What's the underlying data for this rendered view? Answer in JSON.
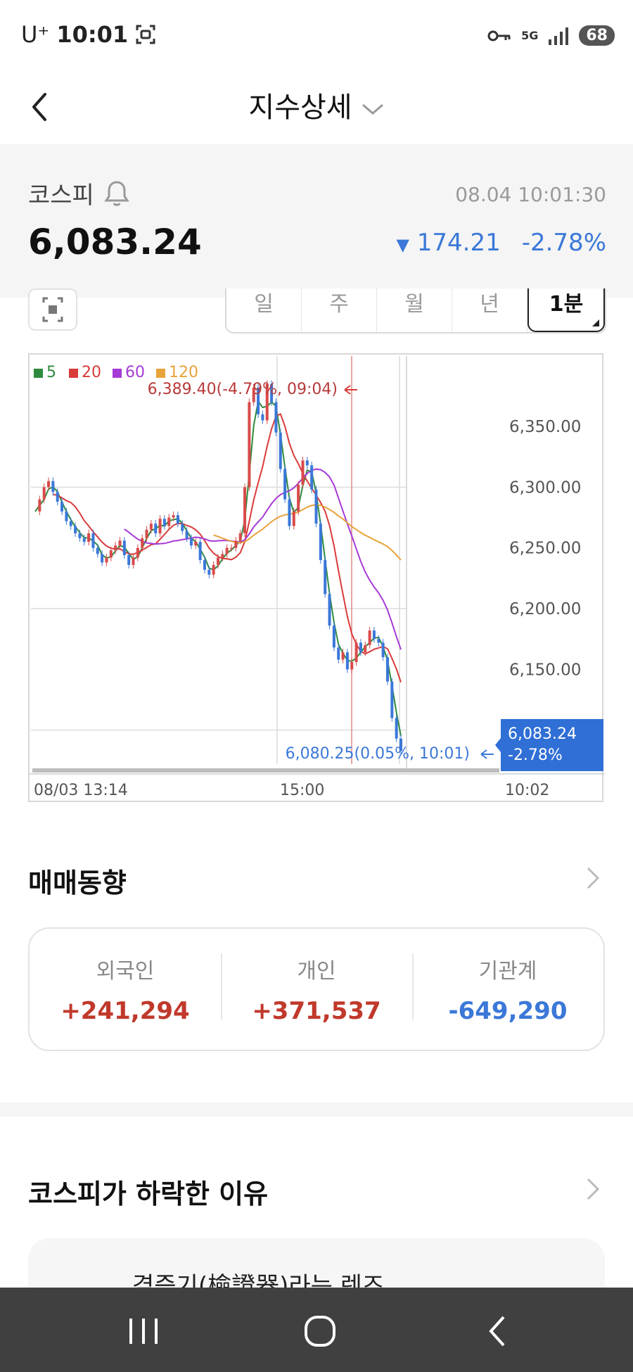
{
  "status_bar": {
    "carrier": "U⁺",
    "time": "10:01",
    "network": "5G",
    "battery": "68"
  },
  "header": {
    "title": "지수상세"
  },
  "index": {
    "name": "코스피",
    "timestamp": "08.04 10:01:30",
    "value": "6,083.24",
    "change_points": "174.21",
    "change_percent": "-2.78%",
    "direction": "down"
  },
  "period_tabs": [
    {
      "label": "일",
      "active": false
    },
    {
      "label": "주",
      "active": false
    },
    {
      "label": "월",
      "active": false
    },
    {
      "label": "년",
      "active": false
    },
    {
      "label": "1분",
      "active": true
    }
  ],
  "chart_data": {
    "type": "candlestick",
    "legend": [
      {
        "label": "5",
        "color": "#2e8b3e"
      },
      {
        "label": "20",
        "color": "#d93b3b"
      },
      {
        "label": "60",
        "color": "#a63ad6"
      },
      {
        "label": "120",
        "color": "#e8a33a"
      }
    ],
    "y_ticks": [
      "6,350.00",
      "6,300.00",
      "6,250.00",
      "6,200.00",
      "6,150.00"
    ],
    "ylim": [
      6072,
      6408
    ],
    "x_ticks": [
      "08/03 13:14",
      "15:00",
      "10:02"
    ],
    "high_marker": "6,389.40(-4.79%, 09:04)",
    "low_marker": "6,080.25(0.05%, 10:01)",
    "current": {
      "value": "6,083.24",
      "change": "-2.78%"
    },
    "price_path": [
      6280,
      6290,
      6300,
      6305,
      6296,
      6288,
      6280,
      6272,
      6268,
      6262,
      6258,
      6255,
      6262,
      6250,
      6245,
      6238,
      6242,
      6248,
      6252,
      6256,
      6244,
      6236,
      6242,
      6250,
      6258,
      6265,
      6270,
      6262,
      6274,
      6268,
      6275,
      6277,
      6270,
      6264,
      6258,
      6252,
      6255,
      6240,
      6232,
      6228,
      6236,
      6242,
      6245,
      6250,
      6250,
      6256,
      6262,
      6300,
      6370,
      6382,
      6360,
      6355,
      6385,
      6370,
      6345,
      6315,
      6290,
      6268,
      6280,
      6302,
      6322,
      6318,
      6298,
      6270,
      6240,
      6212,
      6186,
      6168,
      6158,
      6164,
      6150,
      6156,
      6172,
      6164,
      6170,
      6182,
      6175,
      6172,
      6160,
      6140,
      6110,
      6093,
      6083
    ]
  },
  "trading": {
    "title": "매매동향",
    "items": [
      {
        "label": "외국인",
        "value": "+241,294",
        "sign": "pos"
      },
      {
        "label": "개인",
        "value": "+371,537",
        "sign": "pos"
      },
      {
        "label": "기관계",
        "value": "-649,290",
        "sign": "neg"
      }
    ]
  },
  "reason": {
    "title": "코스피가 하락한 이유",
    "news_preview": "겸증기(檢證器)라는 렌즈"
  },
  "colors": {
    "up": "#c0392b",
    "down": "#3b78d8",
    "candle_up": "#d94a4a",
    "candle_down": "#3b78d8"
  }
}
